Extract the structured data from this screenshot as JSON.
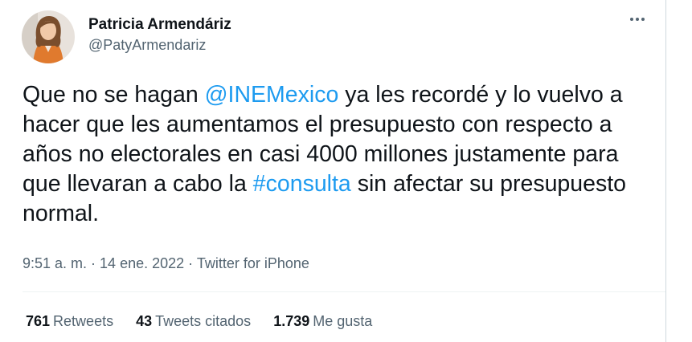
{
  "user": {
    "display_name": "Patricia Armendáriz",
    "handle": "@PatyArmendariz"
  },
  "tweet": {
    "seg1": "Que no se hagan ",
    "mention": "@INEMexico",
    "seg2": " ya les recordé y lo vuelvo a hacer que les aumentamos el presupuesto con respecto a años no electorales en casi 4000 millones justamente para que llevaran a cabo la ",
    "hashtag": "#consulta",
    "seg3": " sin afectar su presupuesto normal."
  },
  "meta": {
    "time": "9:51 a. m.",
    "sep1": " · ",
    "date": "14 ene. 2022",
    "sep2": " · ",
    "source": "Twitter for iPhone"
  },
  "stats": {
    "retweets_count": "761",
    "retweets_label": "Retweets",
    "quotes_count": "43",
    "quotes_label": "Tweets citados",
    "likes_count": "1.739",
    "likes_label": "Me gusta"
  },
  "colors": {
    "link": "#1d9bf0",
    "secondary_text": "#536471",
    "primary_text": "#0f1419"
  },
  "icons": {
    "more": "more-horizontal-icon"
  }
}
